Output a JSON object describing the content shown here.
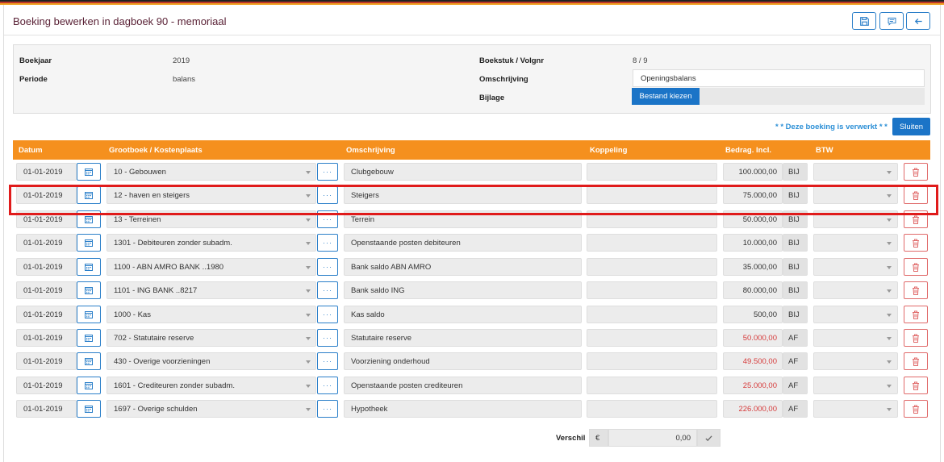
{
  "header": {
    "title": "Boeking bewerken in dagboek 90 - memoriaal"
  },
  "info": {
    "boekjaar_label": "Boekjaar",
    "boekjaar_value": "2019",
    "periode_label": "Periode",
    "periode_value": "balans",
    "boekstuk_label": "Boekstuk / Volgnr",
    "boekstuk_value": "8 / 9",
    "omschrijving_label": "Omschrijving",
    "omschrijving_value": "Openingsbalans",
    "bijlage_label": "Bijlage",
    "file_button": "Bestand kiezen"
  },
  "status": {
    "verwerkt": "* * Deze boeking is verwerkt * *",
    "close_button": "Sluiten"
  },
  "table": {
    "headers": [
      "Datum",
      "Grootboek / Kostenplaats",
      "Omschrijving",
      "Koppeling",
      "Bedrag. Incl.",
      "BTW"
    ],
    "rows": [
      {
        "date": "01-01-2019",
        "ledger": "10 - Gebouwen",
        "desc": "Clubgebouw",
        "amount": "100.000,00",
        "side": "BIJ"
      },
      {
        "date": "01-01-2019",
        "ledger": "12 - haven en steigers",
        "desc": "Steigers",
        "amount": "75.000,00",
        "side": "BIJ"
      },
      {
        "date": "01-01-2019",
        "ledger": "13 - Terreinen",
        "desc": "Terrein",
        "amount": "50.000,00",
        "side": "BIJ"
      },
      {
        "date": "01-01-2019",
        "ledger": "1301 - Debiteuren zonder subadm.",
        "desc": "Openstaande posten debiteuren",
        "amount": "10.000,00",
        "side": "BIJ"
      },
      {
        "date": "01-01-2019",
        "ledger": "1100 - ABN AMRO BANK ..1980",
        "desc": "Bank saldo ABN AMRO",
        "amount": "35.000,00",
        "side": "BIJ"
      },
      {
        "date": "01-01-2019",
        "ledger": "1101 - ING BANK ..8217",
        "desc": "Bank saldo ING",
        "amount": "80.000,00",
        "side": "BIJ"
      },
      {
        "date": "01-01-2019",
        "ledger": "1000 - Kas",
        "desc": "Kas saldo",
        "amount": "500,00",
        "side": "BIJ"
      },
      {
        "date": "01-01-2019",
        "ledger": "702 - Statutaire reserve",
        "desc": "Statutaire reserve",
        "amount": "50.000,00",
        "side": "AF"
      },
      {
        "date": "01-01-2019",
        "ledger": "430 - Overige voorzieningen",
        "desc": "Voorziening onderhoud",
        "amount": "49.500,00",
        "side": "AF"
      },
      {
        "date": "01-01-2019",
        "ledger": "1601 - Crediteuren zonder subadm.",
        "desc": "Openstaande posten crediteuren",
        "amount": "25.000,00",
        "side": "AF"
      },
      {
        "date": "01-01-2019",
        "ledger": "1697 - Overige schulden",
        "desc": "Hypotheek",
        "amount": "226.000,00",
        "side": "AF"
      }
    ]
  },
  "footer": {
    "verschil_label": "Verschil",
    "currency": "€",
    "verschil_value": "0,00"
  },
  "colors": {
    "accent": "#1b74c7",
    "header_orange": "#f5901e",
    "title": "#5a2236",
    "af_amount": "#d63b3b",
    "highlight": "#e01b1b"
  }
}
